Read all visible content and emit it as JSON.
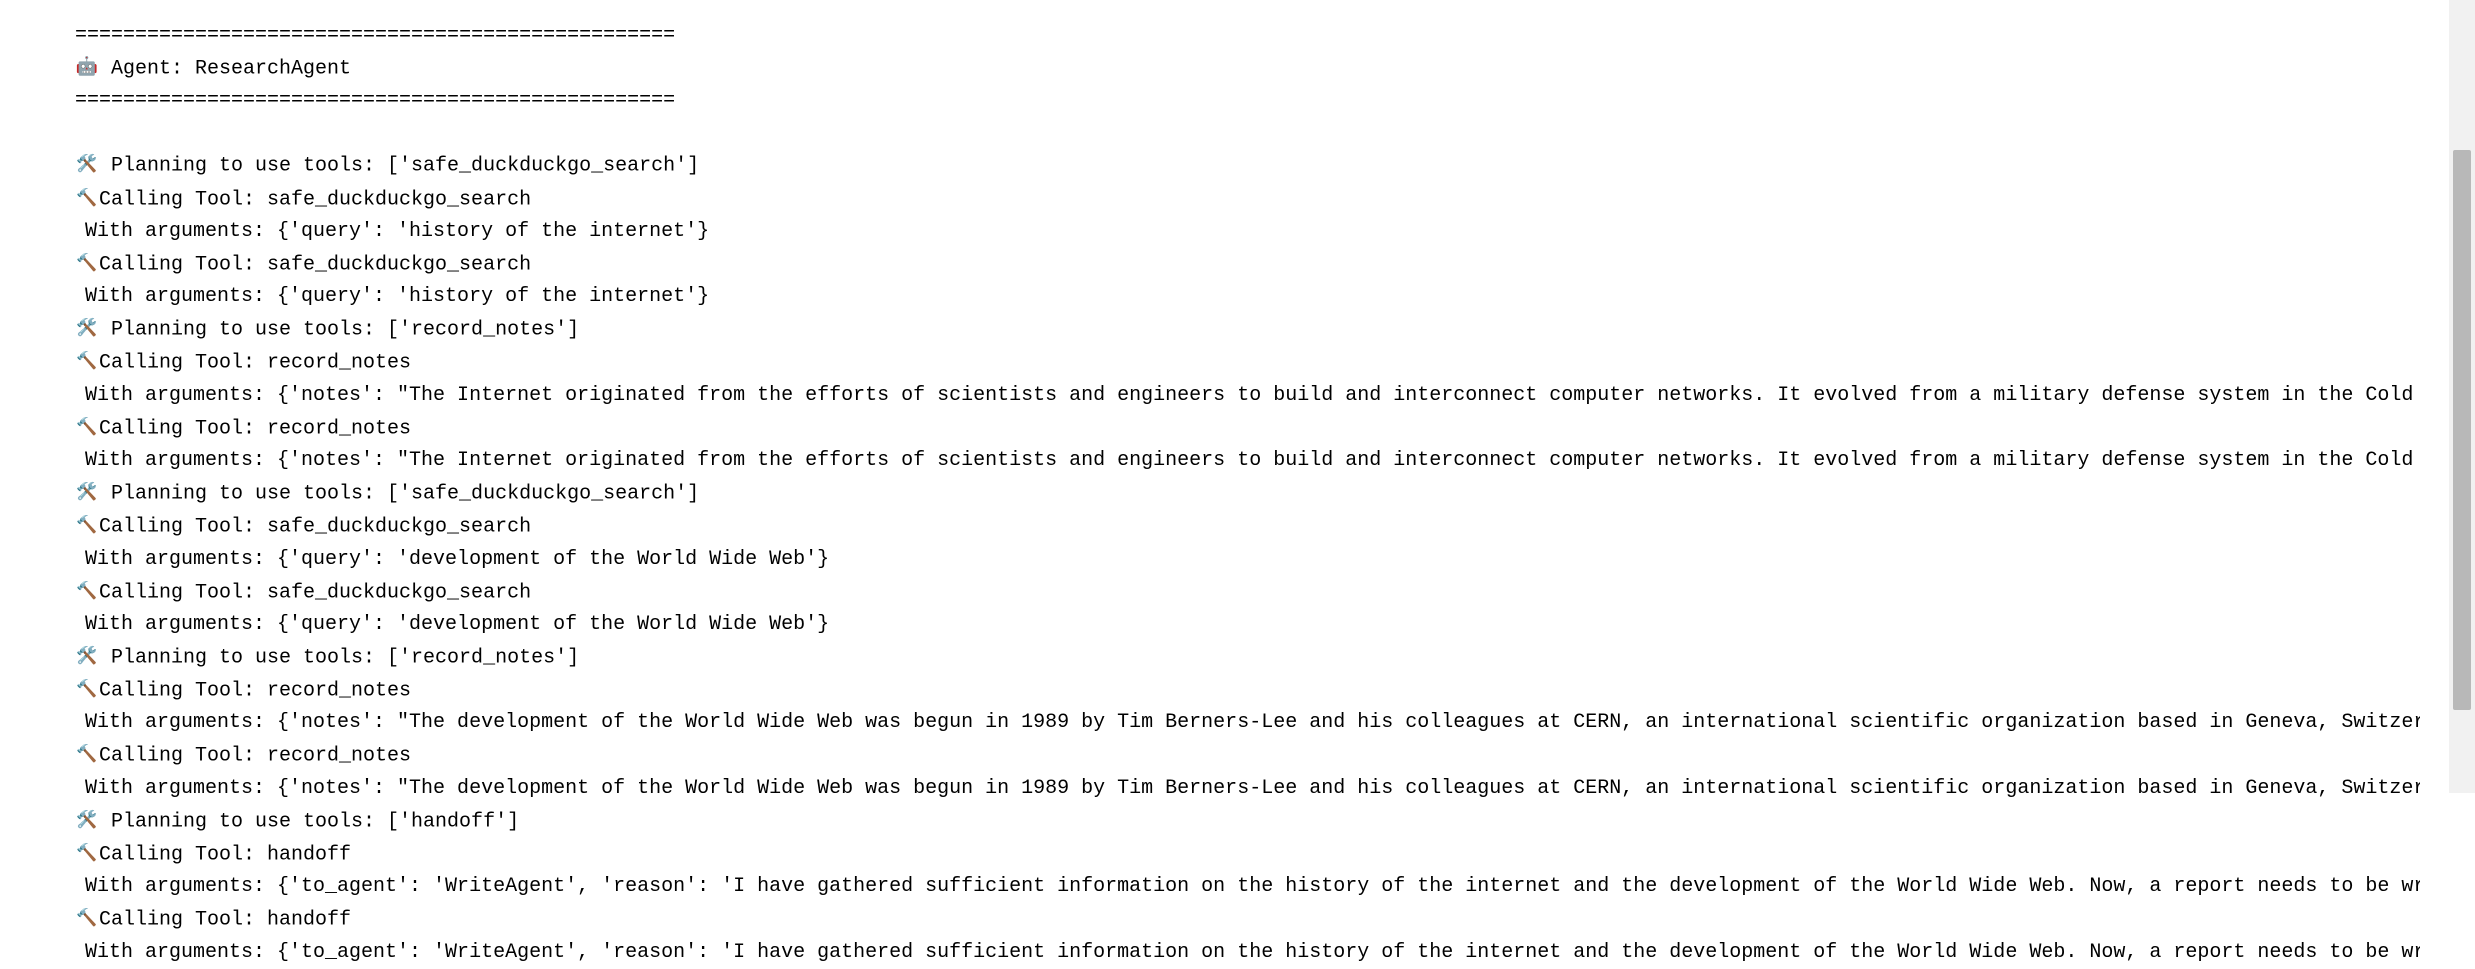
{
  "separator": "==================================================",
  "agent_line": " Agent: ResearchAgent",
  "lines": [
    {
      "type": "plan",
      "text": " Planning to use tools: ['safe_duckduckgo_search']"
    },
    {
      "type": "call",
      "text": "Calling Tool: safe_duckduckgo_search"
    },
    {
      "type": "args",
      "text": "With arguments: {'query': 'history of the internet'}"
    },
    {
      "type": "call",
      "text": "Calling Tool: safe_duckduckgo_search"
    },
    {
      "type": "args",
      "text": "With arguments: {'query': 'history of the internet'}"
    },
    {
      "type": "plan",
      "text": " Planning to use tools: ['record_notes']"
    },
    {
      "type": "call",
      "text": "Calling Tool: record_notes"
    },
    {
      "type": "args",
      "text": "With arguments: {'notes': \"The Internet originated from the efforts of scientists and engineers to build and interconnect computer networks. It evolved from a military defense system in the Cold War to"
    },
    {
      "type": "call",
      "text": "Calling Tool: record_notes"
    },
    {
      "type": "args",
      "text": "With arguments: {'notes': \"The Internet originated from the efforts of scientists and engineers to build and interconnect computer networks. It evolved from a military defense system in the Cold War to"
    },
    {
      "type": "plan",
      "text": " Planning to use tools: ['safe_duckduckgo_search']"
    },
    {
      "type": "call",
      "text": "Calling Tool: safe_duckduckgo_search"
    },
    {
      "type": "args",
      "text": "With arguments: {'query': 'development of the World Wide Web'}"
    },
    {
      "type": "call",
      "text": "Calling Tool: safe_duckduckgo_search"
    },
    {
      "type": "args",
      "text": "With arguments: {'query': 'development of the World Wide Web'}"
    },
    {
      "type": "plan",
      "text": " Planning to use tools: ['record_notes']"
    },
    {
      "type": "call",
      "text": "Calling Tool: record_notes"
    },
    {
      "type": "args",
      "text": "With arguments: {'notes': \"The development of the World Wide Web was begun in 1989 by Tim Berners-Lee and his colleagues at CERN, an international scientific organization based in Geneva, Switzerland. T"
    },
    {
      "type": "call",
      "text": "Calling Tool: record_notes"
    },
    {
      "type": "args",
      "text": "With arguments: {'notes': \"The development of the World Wide Web was begun in 1989 by Tim Berners-Lee and his colleagues at CERN, an international scientific organization based in Geneva, Switzerland. T"
    },
    {
      "type": "plan",
      "text": " Planning to use tools: ['handoff']"
    },
    {
      "type": "call",
      "text": "Calling Tool: handoff"
    },
    {
      "type": "args",
      "text": "With arguments: {'to_agent': 'WriteAgent', 'reason': 'I have gathered sufficient information on the history of the internet and the development of the World Wide Web. Now, a report needs to be written b"
    },
    {
      "type": "call",
      "text": "Calling Tool: handoff"
    },
    {
      "type": "args",
      "text": "With arguments: {'to_agent': 'WriteAgent', 'reason': 'I have gathered sufficient information on the history of the internet and the development of the World Wide Web. Now, a report needs to be written b"
    }
  ]
}
